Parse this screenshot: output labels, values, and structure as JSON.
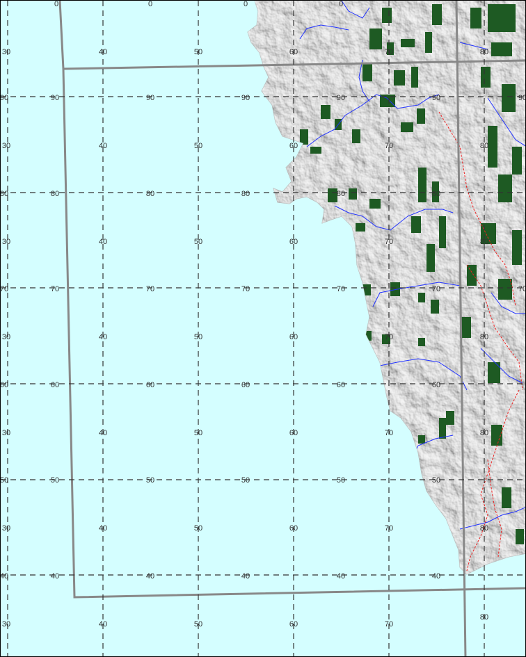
{
  "map": {
    "colors": {
      "ocean": "#d4feff",
      "land": "#dcdcdc",
      "land_shade": "#b8b8b8",
      "land_light": "#f2f2f2",
      "forest": "#1e5a23",
      "river": "#2233ff",
      "trail": "#ee2222",
      "boundary": "#888888",
      "grid": "#333333",
      "label": "#333333"
    },
    "grid_labels": {
      "top_row": [
        "0",
        "0",
        "0",
        "0"
      ],
      "row_1": [
        "30",
        "40",
        "50",
        "60",
        "70",
        "80"
      ],
      "row_2": [
        "90",
        "90",
        "90",
        "90",
        "90",
        "90",
        "90"
      ],
      "row_3": [
        "30",
        "40",
        "50",
        "60",
        "70",
        "80"
      ],
      "row_4": [
        "80",
        "80",
        "80",
        "80",
        "80",
        "80"
      ],
      "row_5": [
        "30",
        "40",
        "50",
        "60",
        "70",
        "80"
      ],
      "row_6": [
        "70",
        "70",
        "70",
        "70",
        "70",
        "70",
        "70"
      ],
      "row_7": [
        "30",
        "40",
        "50",
        "60",
        "70",
        "80"
      ],
      "row_8": [
        "60",
        "60",
        "60",
        "60",
        "60",
        "60"
      ],
      "row_9": [
        "30",
        "40",
        "50",
        "60",
        "70",
        "80"
      ],
      "row_10": [
        "50",
        "50",
        "50",
        "50",
        "50",
        "50"
      ],
      "row_11": [
        "30",
        "40",
        "50",
        "60",
        "70",
        "80"
      ],
      "row_12": [
        "40",
        "40",
        "40",
        "40",
        "40",
        "40"
      ],
      "row_13": [
        "30",
        "40",
        "50",
        "60",
        "70",
        "80"
      ]
    }
  }
}
